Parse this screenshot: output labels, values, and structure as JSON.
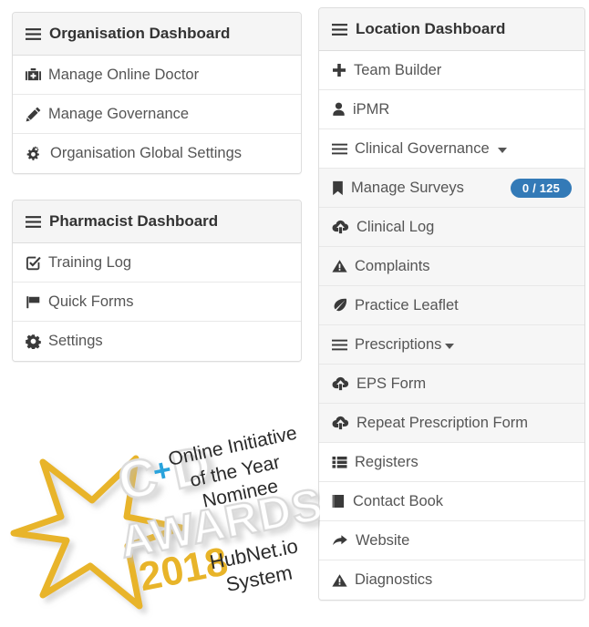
{
  "panels": {
    "organisation": {
      "title": "Organisation Dashboard",
      "title_icon": "bars-icon",
      "items": [
        {
          "label": "Manage Online Doctor",
          "icon": "medkit-icon",
          "hovered": false
        },
        {
          "label": "Manage Governance",
          "icon": "pencil-icon",
          "hovered": false
        },
        {
          "label": "Organisation Global Settings",
          "icon": "cogs-icon",
          "hovered": false
        }
      ]
    },
    "pharmacist": {
      "title": "Pharmacist Dashboard",
      "title_icon": "bars-icon",
      "items": [
        {
          "label": "Training Log",
          "icon": "check-square-icon",
          "hovered": false
        },
        {
          "label": "Quick Forms",
          "icon": "flag-icon",
          "hovered": false
        },
        {
          "label": "Settings",
          "icon": "cog-icon",
          "hovered": false
        }
      ]
    },
    "location": {
      "title": "Location Dashboard",
      "title_icon": "bars-icon",
      "items": [
        {
          "label": "Team Builder",
          "icon": "plus-icon",
          "hovered": false,
          "caret": false
        },
        {
          "label": "iPMR",
          "icon": "user-icon",
          "hovered": false,
          "caret": false
        },
        {
          "label": "Clinical Governance",
          "icon": "bars-icon",
          "hovered": false,
          "caret": "spaced"
        },
        {
          "label": "Manage Surveys",
          "icon": "bookmark-icon",
          "hovered": true,
          "caret": false,
          "badge": "0 / 125"
        },
        {
          "label": "Clinical Log",
          "icon": "cloud-upload-icon",
          "hovered": true,
          "caret": false
        },
        {
          "label": "Complaints",
          "icon": "warning-icon",
          "hovered": true,
          "caret": false
        },
        {
          "label": "Practice Leaflet",
          "icon": "leaf-icon",
          "hovered": true,
          "caret": false
        },
        {
          "label": "Prescriptions",
          "icon": "bars-icon",
          "hovered": true,
          "caret": "tight"
        },
        {
          "label": "EPS Form",
          "icon": "cloud-upload-icon",
          "hovered": true,
          "caret": false
        },
        {
          "label": "Repeat Prescription Form",
          "icon": "cloud-upload-icon",
          "hovered": true,
          "caret": false
        },
        {
          "label": "Registers",
          "icon": "list-icon",
          "hovered": false,
          "caret": false
        },
        {
          "label": "Contact Book",
          "icon": "book-icon",
          "hovered": false,
          "caret": false
        },
        {
          "label": "Website",
          "icon": "share-arrow-icon",
          "hovered": false,
          "caret": false
        },
        {
          "label": "Diagnostics",
          "icon": "warning-icon",
          "hovered": false,
          "caret": false
        }
      ]
    }
  },
  "award": {
    "brand_c": "C",
    "brand_plus": "+",
    "brand_d": "D",
    "awards_word": "AWARDS",
    "year": "2018",
    "line1": "Online Initiative",
    "line2": "of the Year",
    "line3": "Nominee",
    "system1": "HubNet.io",
    "system2": "System",
    "gold": "#e8b429",
    "blue": "#29a3dc",
    "grey": "#e2e2e2"
  },
  "colors": {
    "panel_border": "#dddddd",
    "heading_bg": "#f5f5f5",
    "hover_bg": "#f6f6f6",
    "badge_bg": "#337ab7",
    "text": "#555555",
    "heading_text": "#333333"
  }
}
